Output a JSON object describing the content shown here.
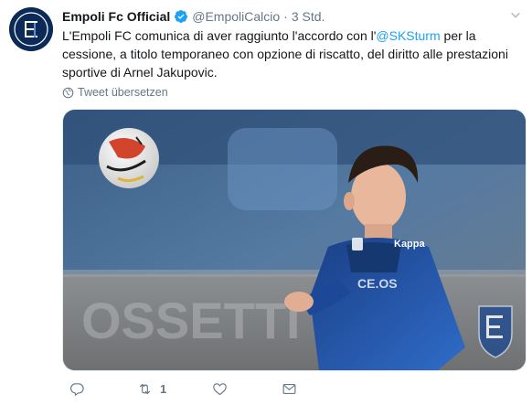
{
  "tweet": {
    "author_name": "Empoli Fc Official",
    "author_handle": "@EmpoliCalcio",
    "separator": "·",
    "time": "3 Std.",
    "text_before": "L'Empoli FC comunica di aver raggiunto l'accordo con l'",
    "mention": "@SKSturm",
    "text_after": " per la cessione, a titolo temporaneo con opzione di riscatto, del diritto alle prestazioni sportive di Arnel Jakupovic.",
    "translate_label": "Tweet übersetzen",
    "retweet_count": "1"
  },
  "media": {
    "description_icons": [
      "ball-icon",
      "crest-icon"
    ],
    "shirt_brand": "Kappa"
  },
  "icons": [
    "reply-icon",
    "retweet-icon",
    "like-icon",
    "dm-icon",
    "globe-icon",
    "verified-icon",
    "caret-down-icon"
  ],
  "colors": {
    "accent": "#1da1f2",
    "muted": "#657786",
    "text": "#14171a",
    "brand_navy": "#0b2a57"
  }
}
